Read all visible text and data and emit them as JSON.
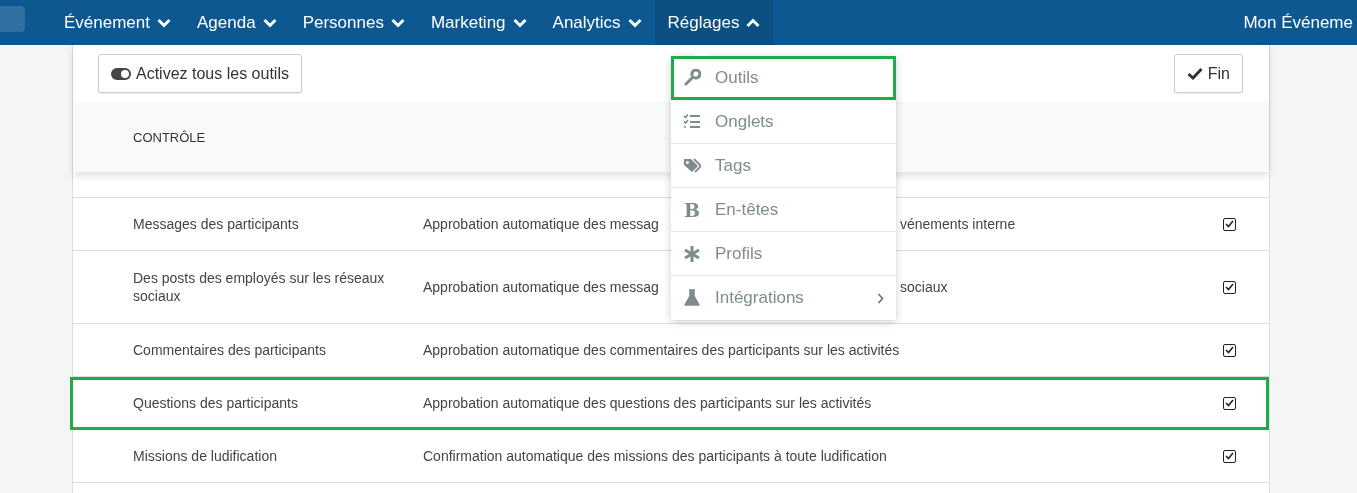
{
  "navbar": {
    "items": [
      {
        "label": "Événement",
        "selected": false
      },
      {
        "label": "Agenda",
        "selected": false
      },
      {
        "label": "Personnes",
        "selected": false
      },
      {
        "label": "Marketing",
        "selected": false
      },
      {
        "label": "Analytics",
        "selected": false
      },
      {
        "label": "Réglages",
        "selected": true
      }
    ],
    "event_name": "Mon Événeme"
  },
  "toolbar": {
    "toggle_all_button": "Activez tous les outils",
    "done_button": "Fin"
  },
  "table": {
    "columns": [
      "CONTRÔLE"
    ],
    "rows": [
      {
        "name": "Messages des participants",
        "description": "Approbation automatique des messag",
        "description_tail": "vénements interne",
        "checked": true,
        "highlighted": false
      },
      {
        "name": "Des posts des employés sur les réseaux sociaux",
        "description": "Approbation automatique des messag",
        "description_tail": "sociaux",
        "checked": true,
        "highlighted": false
      },
      {
        "name": "Commentaires des participants",
        "description": "Approbation automatique des commentaires des participants sur les activités",
        "checked": true,
        "highlighted": false
      },
      {
        "name": "Questions des participants",
        "description": "Approbation automatique des questions des participants sur les activités",
        "checked": true,
        "highlighted": true
      },
      {
        "name": "Missions de ludification",
        "description": "Confirmation automatique des missions des participants à toute ludification",
        "checked": true,
        "highlighted": false
      }
    ]
  },
  "settings_menu": {
    "items": [
      {
        "label": "Outils",
        "highlighted": true
      },
      {
        "label": "Onglets",
        "highlighted": false
      },
      {
        "label": "Tags",
        "highlighted": false
      },
      {
        "label": "En-têtes",
        "highlighted": false,
        "icon": "B"
      },
      {
        "label": "Profils",
        "highlighted": false
      },
      {
        "label": "Intégrations",
        "highlighted": false,
        "submenu": true
      }
    ]
  }
}
